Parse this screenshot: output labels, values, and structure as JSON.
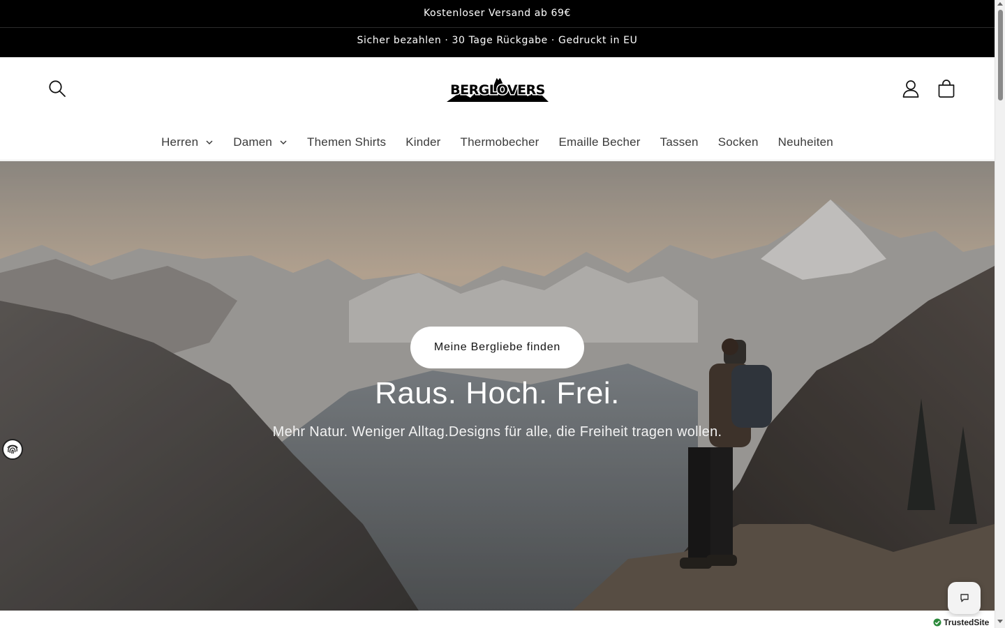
{
  "announcements": {
    "primary": "Kostenloser Versand ab 69€",
    "secondary": "Sicher bezahlen · 30 Tage Rückgabe · Gedruckt in EU"
  },
  "header": {
    "logo_text": "BERGLOVERS",
    "icons": [
      "search-icon",
      "account-icon",
      "cart-icon"
    ]
  },
  "nav": {
    "items": [
      {
        "label": "Herren",
        "has_dropdown": true
      },
      {
        "label": "Damen",
        "has_dropdown": true
      },
      {
        "label": "Themen Shirts",
        "has_dropdown": false
      },
      {
        "label": "Kinder",
        "has_dropdown": false
      },
      {
        "label": "Thermobecher",
        "has_dropdown": false
      },
      {
        "label": "Emaille Becher",
        "has_dropdown": false
      },
      {
        "label": "Tassen",
        "has_dropdown": false
      },
      {
        "label": "Socken",
        "has_dropdown": false
      },
      {
        "label": "Neuheiten",
        "has_dropdown": false
      }
    ]
  },
  "hero": {
    "button_label": "Meine Bergliebe finden",
    "title": "Raus. Hoch. Frei.",
    "subtitle": "Mehr Natur. Weniger Alltag.Designs für alle, die Freiheit tragen wollen."
  },
  "widgets": {
    "trusted_badge": "TrustedSite",
    "chat_icon": "chat-icon",
    "privacy_icon": "fingerprint-icon"
  },
  "colors": {
    "announcement_bg": "#000000",
    "text": "#121212",
    "nav_text": "#3a3a3a",
    "hero_button_bg": "#ffffff"
  }
}
